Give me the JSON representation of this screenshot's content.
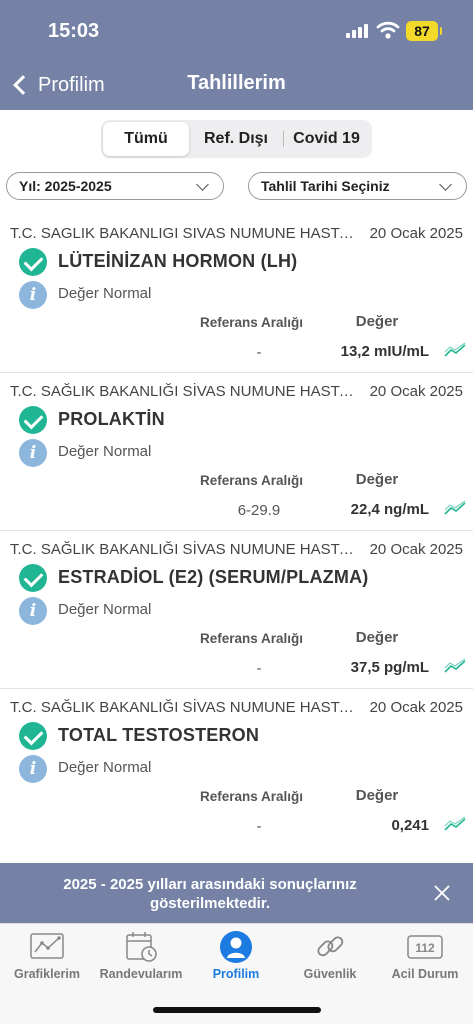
{
  "status_bar": {
    "time": "15:03",
    "battery": "87"
  },
  "nav": {
    "back_label": "Profilim",
    "title": "Tahlillerim"
  },
  "segments": [
    {
      "label": "Tümü",
      "active": true
    },
    {
      "label": "Ref. Dışı",
      "active": false
    },
    {
      "label": "Covid 19",
      "active": false
    }
  ],
  "filters": {
    "year": "Yıl: 2025-2025",
    "date": "Tahlil Tarihi Seçiniz"
  },
  "results": [
    {
      "hospital": "T.C. SAGLIK BAKANLIGI SIVAS NUMUNE HASTANESİ",
      "date": "20 Ocak 2025",
      "test": "LÜTEİNİZAN HORMON (LH)",
      "status": "Değer Normal",
      "ref_header": "Referans Aralığı",
      "val_header": "Değer",
      "ref": "-",
      "value": "13,2 mIU/mL"
    },
    {
      "hospital": "T.C. SAĞLIK BAKANLIĞI SİVAS NUMUNE HASTANESİ",
      "date": "20 Ocak 2025",
      "test": "PROLAKTİN",
      "status": "Değer Normal",
      "ref_header": "Referans Aralığı",
      "val_header": "Değer",
      "ref": "6-29.9",
      "value": "22,4 ng/mL"
    },
    {
      "hospital": "T.C. SAĞLIK BAKANLIĞI SİVAS NUMUNE HASTANESİ",
      "date": "20 Ocak 2025",
      "test": "ESTRADİOL (E2) (SERUM/PLAZMA)",
      "status": "Değer Normal",
      "ref_header": "Referans Aralığı",
      "val_header": "Değer",
      "ref": "-",
      "value": "37,5 pg/mL"
    },
    {
      "hospital": "T.C. SAĞLIK BAKANLIĞI SİVAS NUMUNE HASTANESİ",
      "date": "20 Ocak 2025",
      "test": "TOTAL TESTOSTERON",
      "status": "Değer Normal",
      "ref_header": "Referans Aralığı",
      "val_header": "Değer",
      "ref": "-",
      "value": "0,241"
    }
  ],
  "toast": {
    "text": "2025 - 2025 yılları arasındaki sonuçlarınız gösterilmektedir."
  },
  "tabs": [
    {
      "label": "Grafiklerim",
      "icon": "chart-icon"
    },
    {
      "label": "Randevularım",
      "icon": "calendar-clock-icon"
    },
    {
      "label": "Profilim",
      "icon": "person-icon",
      "active": true
    },
    {
      "label": "Güvenlik",
      "icon": "link-icon"
    },
    {
      "label": "Acil Durum",
      "icon": "emergency-112-icon",
      "badge": "112"
    }
  ],
  "colors": {
    "header_bg": "#7582a6",
    "check_green": "#21b693",
    "info_blue": "#8cb6dc",
    "active_tab": "#1c7be0",
    "battery": "#f3da2a"
  }
}
